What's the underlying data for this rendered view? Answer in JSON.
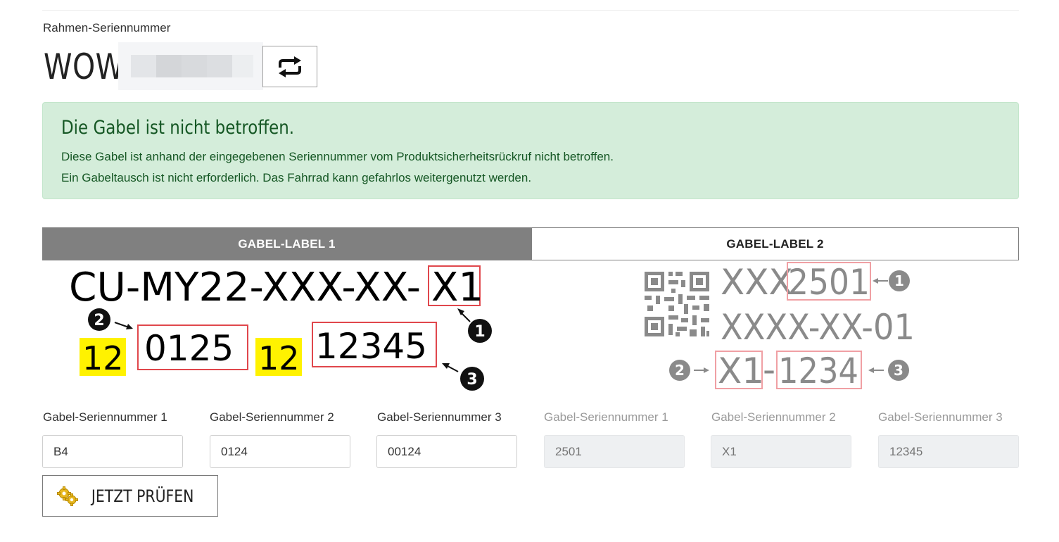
{
  "frame": {
    "label": "Rahmen-Seriennummer",
    "prefix": "WOW",
    "refresh_icon": "refresh-arrows-icon"
  },
  "alert": {
    "title": "Die Gabel ist nicht betroffen.",
    "line1": "Diese Gabel ist anhand der eingegebenen Seriennummer vom Produktsicherheitsrückruf nicht betroffen.",
    "line2": "Ein Gabeltausch ist nicht erforderlich. Das Fahrrad kann gefahrlos weitergenutzt werden.",
    "color": "#155724",
    "background": "#d4edda"
  },
  "tabs": [
    {
      "label": "GABEL-LABEL 1",
      "active": true
    },
    {
      "label": "GABEL-LABEL 2",
      "active": false
    }
  ],
  "label1": {
    "code": "CU-MY22-XXX-XX-",
    "x1": "X1",
    "yellow1": "12",
    "box2": "0125",
    "yellow2": "12",
    "box3": "12345",
    "markers": [
      "1",
      "2",
      "3"
    ]
  },
  "label2": {
    "line1_prefix": "XXX",
    "line1_box": "2501",
    "line2": "XXXX-XX-01",
    "line3_box_a": "X1",
    "line3_sep": "-",
    "line3_box_b": "1234",
    "markers": [
      "1",
      "2",
      "3"
    ]
  },
  "fields": [
    {
      "label": "Gabel-Seriennummer 1",
      "value": "B4",
      "disabled": false
    },
    {
      "label": "Gabel-Seriennummer 2",
      "value": "0124",
      "disabled": false
    },
    {
      "label": "Gabel-Seriennummer 3",
      "value": "00124",
      "disabled": false
    },
    {
      "label": "Gabel-Seriennummer 1",
      "placeholder": "2501",
      "disabled": true
    },
    {
      "label": "Gabel-Seriennummer 2",
      "placeholder": "X1",
      "disabled": true
    },
    {
      "label": "Gabel-Seriennummer 3",
      "placeholder": "12345",
      "disabled": true
    }
  ],
  "check_button": {
    "label": "JETZT PRÜFEN",
    "icon": "gears-icon"
  }
}
